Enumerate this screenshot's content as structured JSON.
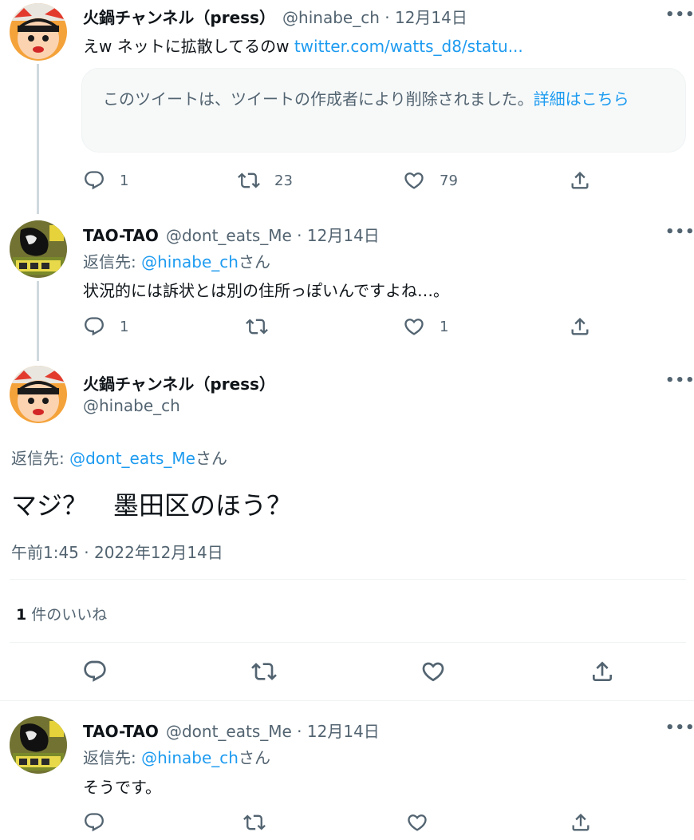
{
  "tweet1": {
    "name": "火鍋チャンネル（press）",
    "handle": "@hinabe_ch",
    "date": "12月14日",
    "text": "えw ネットに拡散してるのw ",
    "link": "twitter.com/watts_d8/statu...",
    "quote_notice": "このツイートは、ツイートの作成者により削除されました。",
    "quote_link": "詳細はこちら",
    "reply_count": "1",
    "retweet_count": "23",
    "like_count": "79"
  },
  "tweet2": {
    "name": "TAO-TAO",
    "handle": "@dont_eats_Me",
    "date": "12月14日",
    "reply_prefix": "返信先: ",
    "reply_to": "@hinabe_ch",
    "reply_suffix": "さん",
    "text": "状況的には訴状とは別の住所っぽいんですよね…。",
    "reply_count": "1",
    "like_count": "1"
  },
  "main_tweet": {
    "name": "火鍋チャンネル（press）",
    "handle": "@hinabe_ch",
    "reply_prefix": "返信先: ",
    "reply_to": "@dont_eats_Me",
    "reply_suffix": "さん",
    "text": "マジ？　墨田区のほう？",
    "timestamp": "午前1:45 · 2022年12月14日",
    "likes_number": "1",
    "likes_label": "件のいいね"
  },
  "tweet4": {
    "name": "TAO-TAO",
    "handle": "@dont_eats_Me",
    "date": "12月14日",
    "reply_prefix": "返信先: ",
    "reply_to": "@hinabe_ch",
    "reply_suffix": "さん",
    "text": "そうです。"
  },
  "separator": " · ",
  "more_label": "•••",
  "icons": [
    "reply-icon",
    "retweet-icon",
    "like-icon",
    "share-icon",
    "more-icon"
  ],
  "colors": {
    "link": "#1d9bf0",
    "secondary": "#536471",
    "thread": "#cfd9de"
  }
}
